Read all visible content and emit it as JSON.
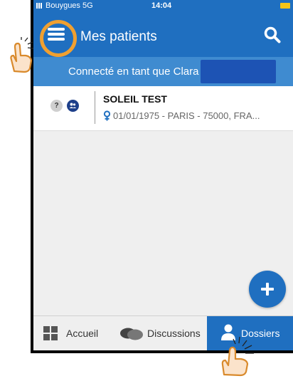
{
  "status_bar": {
    "carrier": "Bouygues 5G",
    "time": "14:04"
  },
  "header": {
    "title": "Mes patients",
    "menu_icon": "hamburger-menu-icon",
    "search_icon": "search-icon"
  },
  "connection": {
    "text": "Connecté en tant que Clara"
  },
  "patients": [
    {
      "name": "SOLEIL TEST",
      "info": "01/01/1975 - PARIS - 75000, FRA...",
      "status_badge": "?",
      "gender_icon": "female-icon"
    }
  ],
  "fab": {
    "icon": "plus-icon"
  },
  "tabs": [
    {
      "label": "Accueil",
      "icon": "grid-icon",
      "active": false
    },
    {
      "label": "Discussions",
      "icon": "chat-bubbles-icon",
      "active": false
    },
    {
      "label": "Dossiers",
      "icon": "user-icon",
      "active": true
    }
  ],
  "colors": {
    "primary": "#1f6fc0",
    "connection_bar": "#3f8bd0",
    "highlight_ring": "#f0a030",
    "background": "#efefef"
  }
}
